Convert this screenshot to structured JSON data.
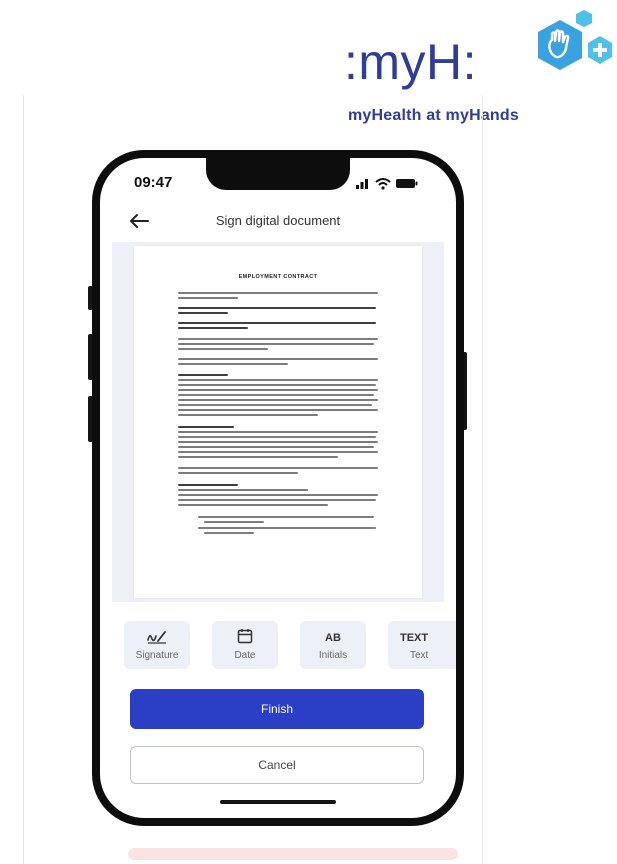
{
  "logo": {
    "text": ":myH:",
    "tagline": "myHealth at myHands",
    "colors": {
      "navy": "#2f3d9a",
      "hex": "#3aa3df",
      "hex_light": "#4fc0e8"
    }
  },
  "status_bar": {
    "time": "09:47"
  },
  "header": {
    "title": "Sign digital document"
  },
  "document": {
    "title": "EMPLOYMENT CONTRACT"
  },
  "toolbar": {
    "items": [
      {
        "label": "Signature",
        "icon": "signature-icon"
      },
      {
        "label": "Date",
        "icon": "calendar-icon"
      },
      {
        "label": "Initials",
        "icon": "initials-icon",
        "glyph": "AB"
      },
      {
        "label": "Text",
        "icon": "text-icon",
        "glyph": "TEXT"
      }
    ]
  },
  "buttons": {
    "finish": "Finish",
    "cancel": "Cancel"
  },
  "colors": {
    "primary": "#2a3fc6",
    "panel": "#eef0f7"
  }
}
